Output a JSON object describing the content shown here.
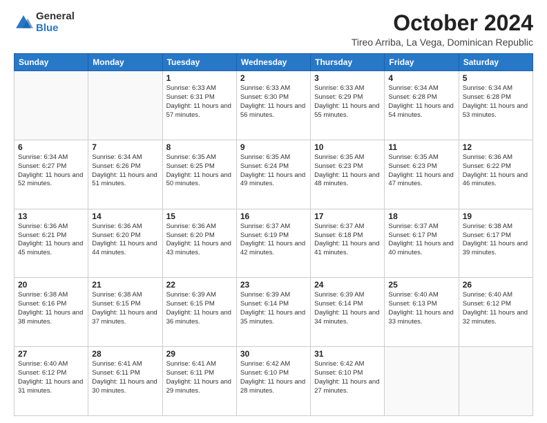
{
  "logo": {
    "general": "General",
    "blue": "Blue"
  },
  "title": "October 2024",
  "subtitle": "Tireo Arriba, La Vega, Dominican Republic",
  "days_of_week": [
    "Sunday",
    "Monday",
    "Tuesday",
    "Wednesday",
    "Thursday",
    "Friday",
    "Saturday"
  ],
  "weeks": [
    [
      {
        "day": "",
        "info": ""
      },
      {
        "day": "",
        "info": ""
      },
      {
        "day": "1",
        "info": "Sunrise: 6:33 AM\nSunset: 6:31 PM\nDaylight: 11 hours and 57 minutes."
      },
      {
        "day": "2",
        "info": "Sunrise: 6:33 AM\nSunset: 6:30 PM\nDaylight: 11 hours and 56 minutes."
      },
      {
        "day": "3",
        "info": "Sunrise: 6:33 AM\nSunset: 6:29 PM\nDaylight: 11 hours and 55 minutes."
      },
      {
        "day": "4",
        "info": "Sunrise: 6:34 AM\nSunset: 6:28 PM\nDaylight: 11 hours and 54 minutes."
      },
      {
        "day": "5",
        "info": "Sunrise: 6:34 AM\nSunset: 6:28 PM\nDaylight: 11 hours and 53 minutes."
      }
    ],
    [
      {
        "day": "6",
        "info": "Sunrise: 6:34 AM\nSunset: 6:27 PM\nDaylight: 11 hours and 52 minutes."
      },
      {
        "day": "7",
        "info": "Sunrise: 6:34 AM\nSunset: 6:26 PM\nDaylight: 11 hours and 51 minutes."
      },
      {
        "day": "8",
        "info": "Sunrise: 6:35 AM\nSunset: 6:25 PM\nDaylight: 11 hours and 50 minutes."
      },
      {
        "day": "9",
        "info": "Sunrise: 6:35 AM\nSunset: 6:24 PM\nDaylight: 11 hours and 49 minutes."
      },
      {
        "day": "10",
        "info": "Sunrise: 6:35 AM\nSunset: 6:23 PM\nDaylight: 11 hours and 48 minutes."
      },
      {
        "day": "11",
        "info": "Sunrise: 6:35 AM\nSunset: 6:23 PM\nDaylight: 11 hours and 47 minutes."
      },
      {
        "day": "12",
        "info": "Sunrise: 6:36 AM\nSunset: 6:22 PM\nDaylight: 11 hours and 46 minutes."
      }
    ],
    [
      {
        "day": "13",
        "info": "Sunrise: 6:36 AM\nSunset: 6:21 PM\nDaylight: 11 hours and 45 minutes."
      },
      {
        "day": "14",
        "info": "Sunrise: 6:36 AM\nSunset: 6:20 PM\nDaylight: 11 hours and 44 minutes."
      },
      {
        "day": "15",
        "info": "Sunrise: 6:36 AM\nSunset: 6:20 PM\nDaylight: 11 hours and 43 minutes."
      },
      {
        "day": "16",
        "info": "Sunrise: 6:37 AM\nSunset: 6:19 PM\nDaylight: 11 hours and 42 minutes."
      },
      {
        "day": "17",
        "info": "Sunrise: 6:37 AM\nSunset: 6:18 PM\nDaylight: 11 hours and 41 minutes."
      },
      {
        "day": "18",
        "info": "Sunrise: 6:37 AM\nSunset: 6:17 PM\nDaylight: 11 hours and 40 minutes."
      },
      {
        "day": "19",
        "info": "Sunrise: 6:38 AM\nSunset: 6:17 PM\nDaylight: 11 hours and 39 minutes."
      }
    ],
    [
      {
        "day": "20",
        "info": "Sunrise: 6:38 AM\nSunset: 6:16 PM\nDaylight: 11 hours and 38 minutes."
      },
      {
        "day": "21",
        "info": "Sunrise: 6:38 AM\nSunset: 6:15 PM\nDaylight: 11 hours and 37 minutes."
      },
      {
        "day": "22",
        "info": "Sunrise: 6:39 AM\nSunset: 6:15 PM\nDaylight: 11 hours and 36 minutes."
      },
      {
        "day": "23",
        "info": "Sunrise: 6:39 AM\nSunset: 6:14 PM\nDaylight: 11 hours and 35 minutes."
      },
      {
        "day": "24",
        "info": "Sunrise: 6:39 AM\nSunset: 6:14 PM\nDaylight: 11 hours and 34 minutes."
      },
      {
        "day": "25",
        "info": "Sunrise: 6:40 AM\nSunset: 6:13 PM\nDaylight: 11 hours and 33 minutes."
      },
      {
        "day": "26",
        "info": "Sunrise: 6:40 AM\nSunset: 6:12 PM\nDaylight: 11 hours and 32 minutes."
      }
    ],
    [
      {
        "day": "27",
        "info": "Sunrise: 6:40 AM\nSunset: 6:12 PM\nDaylight: 11 hours and 31 minutes."
      },
      {
        "day": "28",
        "info": "Sunrise: 6:41 AM\nSunset: 6:11 PM\nDaylight: 11 hours and 30 minutes."
      },
      {
        "day": "29",
        "info": "Sunrise: 6:41 AM\nSunset: 6:11 PM\nDaylight: 11 hours and 29 minutes."
      },
      {
        "day": "30",
        "info": "Sunrise: 6:42 AM\nSunset: 6:10 PM\nDaylight: 11 hours and 28 minutes."
      },
      {
        "day": "31",
        "info": "Sunrise: 6:42 AM\nSunset: 6:10 PM\nDaylight: 11 hours and 27 minutes."
      },
      {
        "day": "",
        "info": ""
      },
      {
        "day": "",
        "info": ""
      }
    ]
  ]
}
